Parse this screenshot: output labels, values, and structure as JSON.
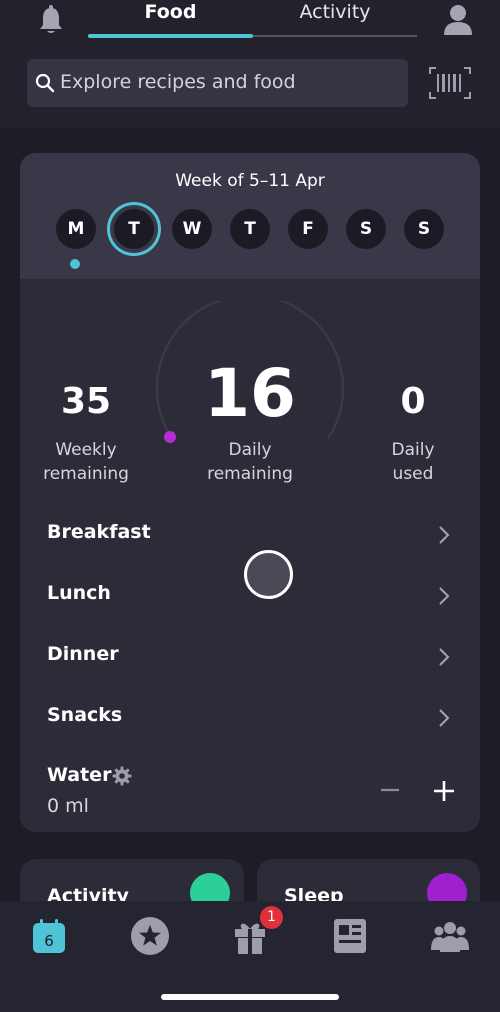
{
  "header": {
    "tabs": [
      {
        "label": "Food",
        "active": true
      },
      {
        "label": "Activity",
        "active": false
      }
    ],
    "icons": {
      "left": "bell-icon",
      "right": "profile-icon"
    }
  },
  "search": {
    "placeholder": "Explore recipes and food",
    "scan_icon": "barcode-icon"
  },
  "week": {
    "title": "Week of 5–11 Apr",
    "days": [
      "M",
      "T",
      "W",
      "T",
      "F",
      "S",
      "S"
    ],
    "selected_index": 1
  },
  "summary": {
    "weekly_remaining": "35",
    "weekly_label_1": "Weekly",
    "weekly_label_2": "remaining",
    "daily_remaining": "16",
    "daily_label_1": "Daily",
    "daily_label_2": "remaining",
    "daily_used": "0",
    "used_label_1": "Daily",
    "used_label_2": "used"
  },
  "meals": [
    {
      "label": "Breakfast"
    },
    {
      "label": "Lunch"
    },
    {
      "label": "Dinner"
    },
    {
      "label": "Snacks"
    }
  ],
  "water": {
    "label": "Water",
    "value": "0 ml"
  },
  "cards": {
    "activity": "Activity",
    "sleep": "Sleep"
  },
  "nav": {
    "calendar_day": "6",
    "gift_badge": "1"
  },
  "colors": {
    "accent": "#4fc4d6",
    "gauge_dot": "#b72ad8",
    "activity": "#2ccf9a",
    "sleep": "#a020d0",
    "badge": "#e0303a"
  }
}
